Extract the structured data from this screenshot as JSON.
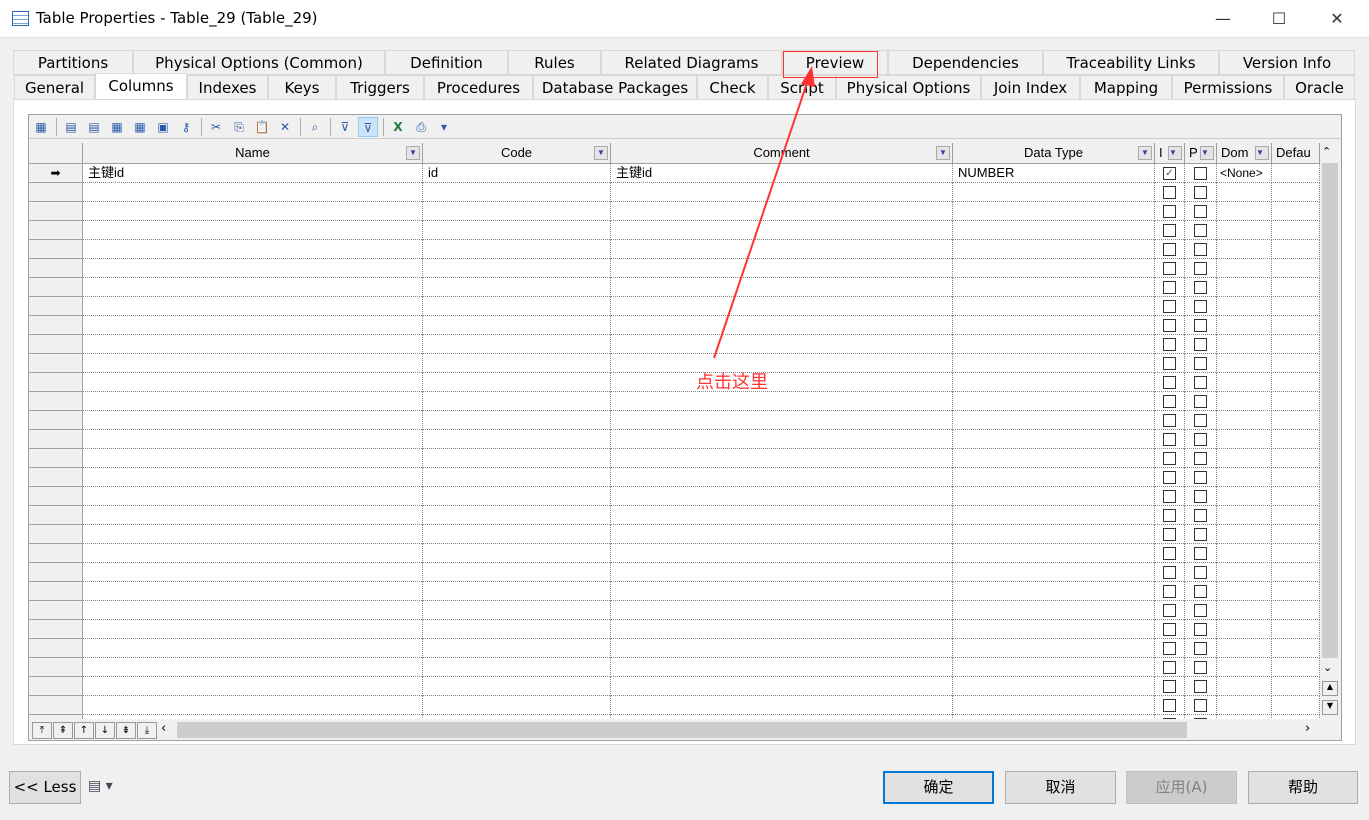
{
  "window": {
    "title": "Table Properties - Table_29 (Table_29)",
    "minimize": "—",
    "maximize": "☐",
    "close": "✕"
  },
  "tabs_row1": [
    "Partitions",
    "Physical Options (Common)",
    "Definition",
    "Rules",
    "Related Diagrams",
    "Preview",
    "Dependencies",
    "Traceability Links",
    "Version Info"
  ],
  "tabs_row2": [
    "General",
    "Columns",
    "Indexes",
    "Keys",
    "Triggers",
    "Procedures",
    "Database Packages",
    "Check",
    "Script",
    "Physical Options",
    "Join Index",
    "Mapping",
    "Permissions",
    "Oracle"
  ],
  "active_tab": "Columns",
  "grid": {
    "headers": [
      "Name",
      "Code",
      "Comment",
      "Data Type",
      "I",
      "P",
      "Dom",
      "Defau"
    ],
    "rows": [
      {
        "name": "主键id",
        "code": "id",
        "comment": "主键id",
        "data_type": "NUMBER",
        "identity": true,
        "primary": false,
        "domain": "<None>",
        "default": ""
      }
    ],
    "current_row_marker": "➡"
  },
  "annotation": {
    "text": "点击这里",
    "color": "#ff3333",
    "target": "Preview"
  },
  "footer": {
    "less": "<< Less",
    "ok": "确定",
    "cancel": "取消",
    "apply": "应用(A)",
    "help": "帮助"
  }
}
